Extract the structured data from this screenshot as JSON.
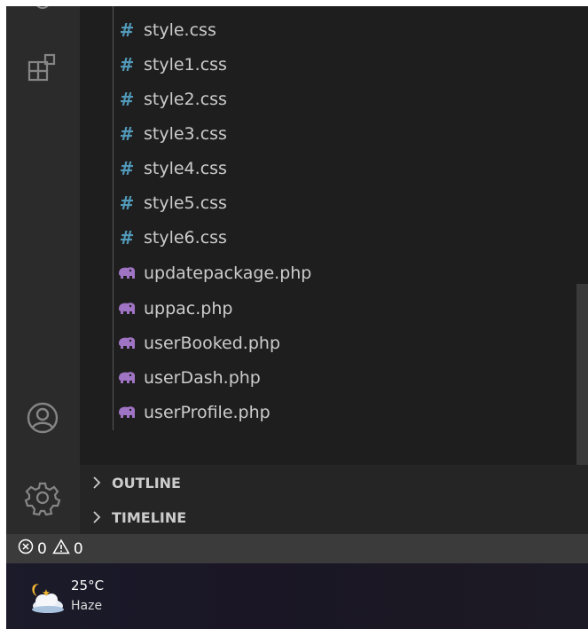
{
  "explorer": {
    "files": [
      {
        "name": "style.css",
        "icon": "css-file-icon",
        "type": "css"
      },
      {
        "name": "style1.css",
        "icon": "css-file-icon",
        "type": "css"
      },
      {
        "name": "style2.css",
        "icon": "css-file-icon",
        "type": "css"
      },
      {
        "name": "style3.css",
        "icon": "css-file-icon",
        "type": "css"
      },
      {
        "name": "style4.css",
        "icon": "css-file-icon",
        "type": "css"
      },
      {
        "name": "style5.css",
        "icon": "css-file-icon",
        "type": "css"
      },
      {
        "name": "style6.css",
        "icon": "css-file-icon",
        "type": "css"
      },
      {
        "name": "updatepackage.php",
        "icon": "php-file-icon",
        "type": "php"
      },
      {
        "name": "uppac.php",
        "icon": "php-file-icon",
        "type": "php"
      },
      {
        "name": "userBooked.php",
        "icon": "php-file-icon",
        "type": "php"
      },
      {
        "name": "userDash.php",
        "icon": "php-file-icon",
        "type": "php"
      },
      {
        "name": "userProfile.php",
        "icon": "php-file-icon",
        "type": "php"
      }
    ],
    "css_icon_glyph": "#"
  },
  "sections": {
    "outline": "OUTLINE",
    "timeline": "TIMELINE"
  },
  "statusbar": {
    "errors": "0",
    "warnings": "0"
  },
  "taskbar": {
    "weather": {
      "temperature": "25°C",
      "condition": "Haze"
    }
  },
  "colors": {
    "css_icon": "#519aba",
    "php_icon": "#a074c4",
    "editor_bg": "#1e1e1e",
    "sidebar_bg": "#252526",
    "statusbar_bg": "#3b3b3b"
  }
}
